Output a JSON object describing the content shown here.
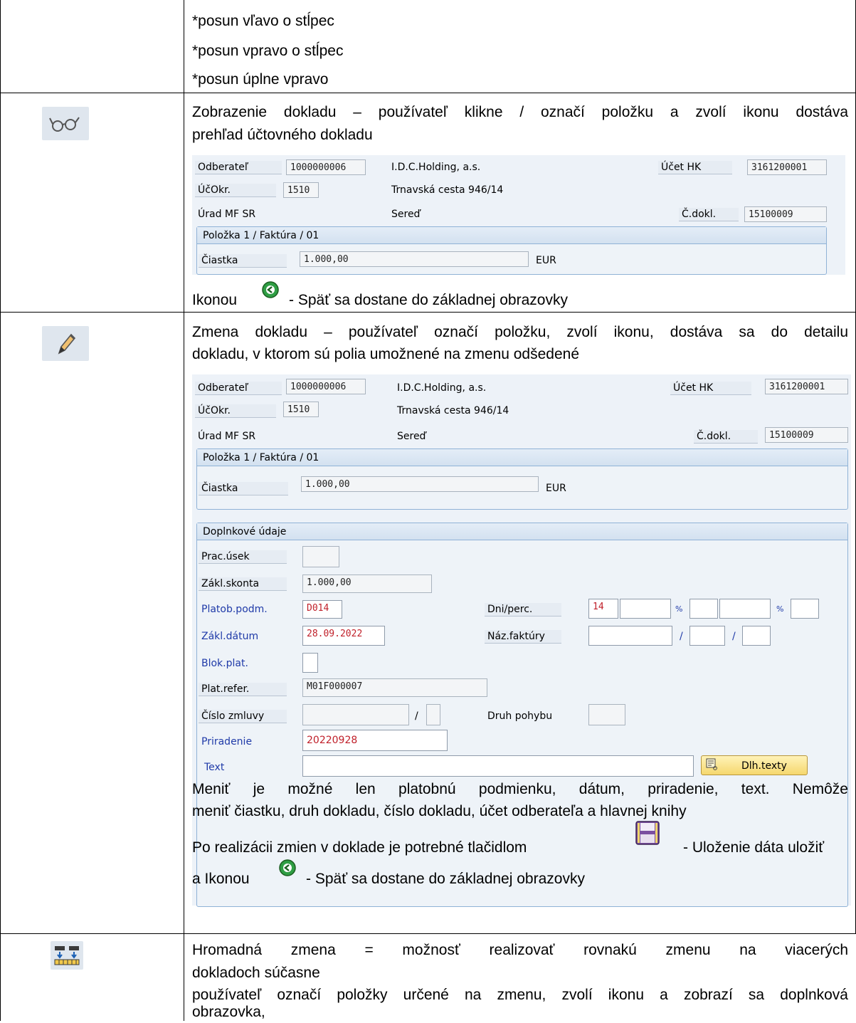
{
  "row1": {
    "lines": [
      "*posun vľavo o stĺpec",
      "*posun vpravo o stĺpec",
      "*posun úplne vpravo"
    ]
  },
  "row2": {
    "icon": "glasses-icon",
    "desc_lines": [
      "Zobrazenie dokladu – používateľ klikne / označí položku a zvolí ikonu dostáva",
      "prehľad účtovného dokladu"
    ],
    "back_prefix": "Ikonou",
    "back_suffix": "- Späť sa dostane do základnej obrazovky"
  },
  "row3": {
    "icon": "pencil-icon",
    "desc_lines": [
      "Zmena dokladu – používateľ označí položku, zvolí ikonu, dostáva sa do detailu",
      "dokladu, v ktorom sú polia umožnené na zmenu odšedené"
    ],
    "note_lines": [
      "Meniť je možné len platobnú podmienku, dátum, priradenie, text. Nemôže",
      "meniť čiastku, druh dokladu, číslo dokladu, účet odberateľa a hlavnej knihy"
    ],
    "save_prefix": "Po realizácii zmien v doklade je potrebné tlačidlom",
    "save_suffix": "- Uloženie dáta uložiť",
    "back_prefix": "a Ikonou",
    "back_suffix": "- Späť sa dostane do základnej obrazovky"
  },
  "row4": {
    "icon": "mass-change-icon",
    "desc_lines": [
      "Hromadná zmena = možnosť realizovať rovnakú zmenu na viacerých",
      "dokladoch súčasne"
    ],
    "desc2_lines": [
      "používateľ označí položky určené na zmenu, zvolí ikonu a zobrazí sa doplnková",
      "obrazovka,"
    ]
  },
  "sap_header": {
    "odberatel_label": "Odberateľ",
    "odberatel_value": "1000000006",
    "company": "I.D.C.Holding, a.s.",
    "ucet_hk_label": "Účet HK",
    "ucet_hk_value": "3161200001",
    "ucokr_label": "ÚčOkr.",
    "ucokr_value": "1510",
    "street": "Trnavská cesta 946/14",
    "urad": "Úrad MF SR",
    "city": "Sereď",
    "cdokl_label": "Č.dokl.",
    "cdokl_value": "15100009",
    "polozka_title": "Položka 1 / Faktúra / 01",
    "ciastka_label": "Čiastka",
    "ciastka_value": "1.000,00",
    "currency": "EUR"
  },
  "sap_extra": {
    "title": "Doplnkové údaje",
    "prac_usek_label": "Prac.úsek",
    "zakl_skonta_label": "Zákl.skonta",
    "zakl_skonta_value": "1.000,00",
    "platob_podm_label": "Platob.podm.",
    "platob_podm_value": "D014",
    "dni_perc_label": "Dni/perc.",
    "dni_value": "14",
    "percent_sign_1": "%",
    "percent_sign_2": "%",
    "zakl_datum_label": "Zákl.dátum",
    "zakl_datum_value": "28.09.2022",
    "naz_faktury_label": "Náz.faktúry",
    "slash": "/",
    "blok_plat_label": "Blok.plat.",
    "plat_refer_label": "Plat.refer.",
    "plat_refer_value": "M01F000007",
    "cislo_zmluvy_label": "Číslo zmluvy",
    "druh_pohybu_label": "Druh pohybu",
    "priradenie_label": "Priradenie",
    "priradenie_value": "20220928",
    "text_label": "Text",
    "dlh_texty_button": "Dlh.texty"
  },
  "colors": {
    "sap_bg": "#edf2f8",
    "label_blue": "#1f3aa8",
    "value_red": "#c0202a",
    "group_border": "#8fb2d6"
  }
}
